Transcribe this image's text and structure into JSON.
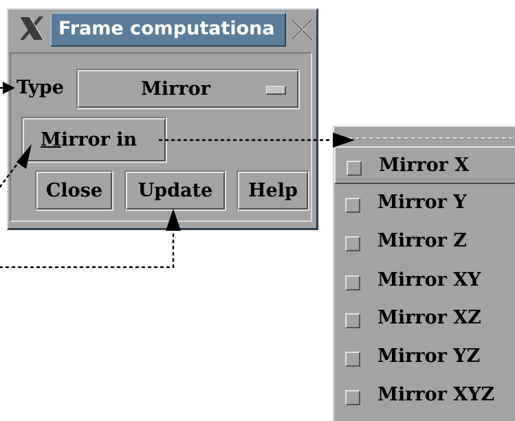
{
  "dialog": {
    "title": "Frame computationa",
    "type_label": "Type",
    "type_value": "Mirror",
    "mirror_in_mnemonic": "M",
    "mirror_in_rest": "irror in",
    "buttons": {
      "close": "Close",
      "update": "Update",
      "help": "Help"
    }
  },
  "menu": {
    "items": [
      {
        "label": "Mirror X"
      },
      {
        "label": "Mirror Y"
      },
      {
        "label": "Mirror Z"
      },
      {
        "label": "Mirror XY"
      },
      {
        "label": "Mirror XZ"
      },
      {
        "label": "Mirror YZ"
      },
      {
        "label": "Mirror XYZ"
      }
    ]
  },
  "icons": {
    "window_menu": "close-x-icon",
    "minimize": "minimize-x-icon",
    "option_indicator": "option-menu-indicator-icon",
    "toggle": "toggle-square-icon"
  },
  "colors": {
    "panel": "#a3a3a3",
    "title_bar": "#5c7d99",
    "border_dark": "#2f3f52"
  }
}
